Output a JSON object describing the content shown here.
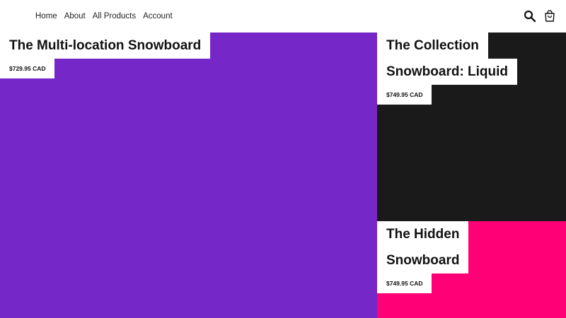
{
  "nav": {
    "links": [
      "Home",
      "About",
      "All Products",
      "Account"
    ]
  },
  "icons": {
    "search": "search-icon",
    "cart": "shopping-bag-icon"
  },
  "products": [
    {
      "title_lines": [
        "The Multi-location Snowboard"
      ],
      "price": "$729.95 CAD",
      "color": "#7627c8"
    },
    {
      "title_lines": [
        "The Collection",
        "Snowboard: Liquid"
      ],
      "price": "$749.95 CAD",
      "color": "#1a1a1a"
    },
    {
      "title_lines": [
        "The Hidden",
        "Snowboard"
      ],
      "price": "$749.95 CAD",
      "color": "#ff0077"
    }
  ]
}
